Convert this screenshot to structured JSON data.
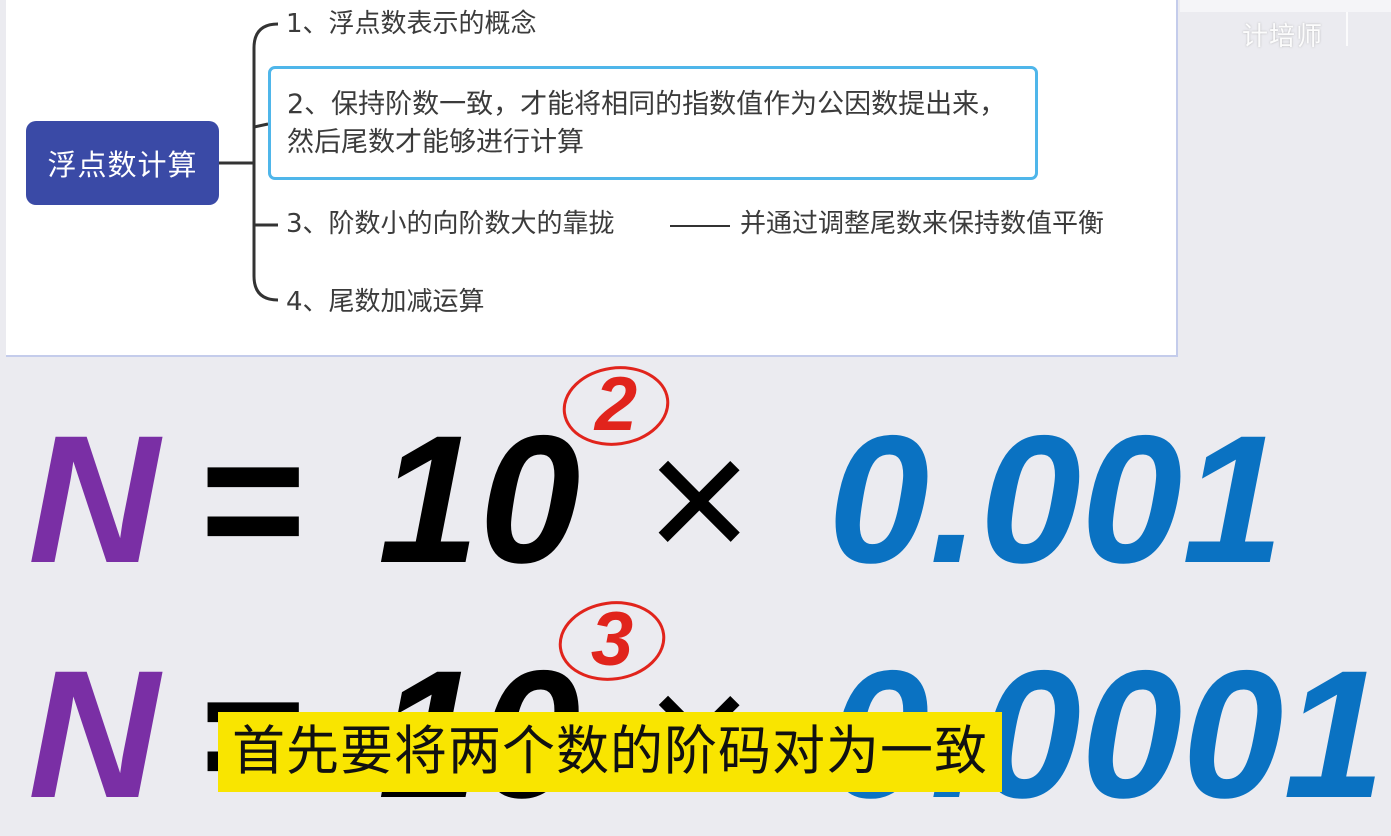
{
  "mindmap": {
    "root": "浮点数计算",
    "branches": [
      "1、浮点数表示的概念",
      "2、保持阶数一致，才能将相同的指数值作为公因数提出来，然后尾数才能够进行计算",
      "3、阶数小的向阶数大的靠拢",
      "4、尾数加减运算"
    ],
    "branch3_sub": "并通过调整尾数来保持数值平衡"
  },
  "watermark": "计培师",
  "formulas": [
    {
      "lhs": "N",
      "eq": "=",
      "base": "10",
      "exponent": "2",
      "times": "×",
      "mantissa": "0.001"
    },
    {
      "lhs": "N",
      "eq": "=",
      "base": "10",
      "exponent": "3",
      "times": "×",
      "mantissa": "0.0001"
    }
  ],
  "subtitle": "首先要将两个数的阶码对为一致",
  "colors": {
    "root_node": "#3a4aa6",
    "selected_border": "#4fb6ea",
    "variable": "#7a2fa5",
    "mantissa": "#0a72c2",
    "exponent": "#e1241c",
    "subtitle_bg": "#f9e500"
  }
}
